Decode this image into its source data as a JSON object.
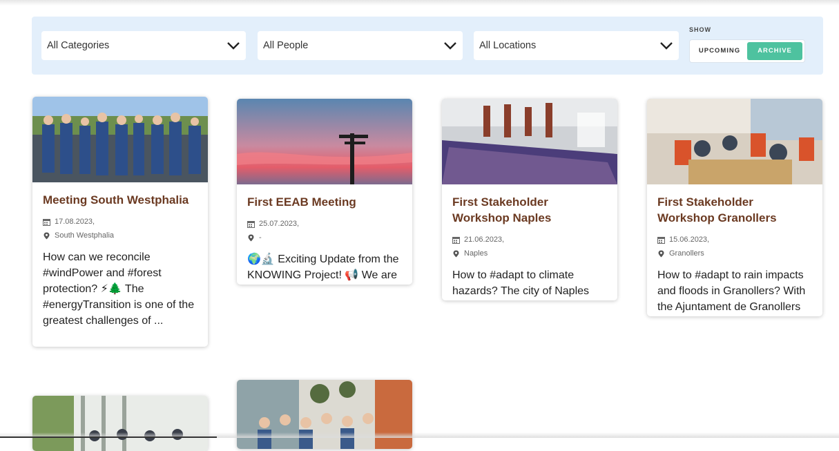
{
  "filters": {
    "categories": "All Categories",
    "people": "All People",
    "locations": "All Locations",
    "show_label": "SHOW",
    "upcoming": "UPCOMING",
    "archive": "ARCHIVE",
    "active": "archive"
  },
  "events": [
    {
      "title": "Meeting South Westphalia",
      "date": "17.08.2023,",
      "location": "South Westphalia",
      "description": "How can we reconcile #windPower and #forest protection? ⚡🌲 The #energyTransition is one of the greatest challenges of ..."
    },
    {
      "title": "First EEAB Meeting",
      "date": "25.07.2023,",
      "location": "-",
      "description": "🌍🔬 Exciting Update from the KNOWING Project! 📢 We are thrilled to share that the KNOWING project conducted a highl..."
    },
    {
      "title": "First Stakeholder Workshop Naples",
      "date": "21.06.2023,",
      "location": "Naples",
      "description": "How to #adapt to climate hazards? The city of Naples invited stakeholders to learn from their input and think about new pat..."
    },
    {
      "title": "First Stakeholder Workshop Granollers",
      "date": "15.06.2023,",
      "location": "Granollers",
      "description": "How to #adapt to rain impacts and floods in Granollers? With the Ajuntament de Granollers stakeholders participate in a fir..."
    }
  ],
  "colors": {
    "accent": "#4ec29f",
    "title": "#6b3a22",
    "filter_bg": "#e3effb"
  }
}
